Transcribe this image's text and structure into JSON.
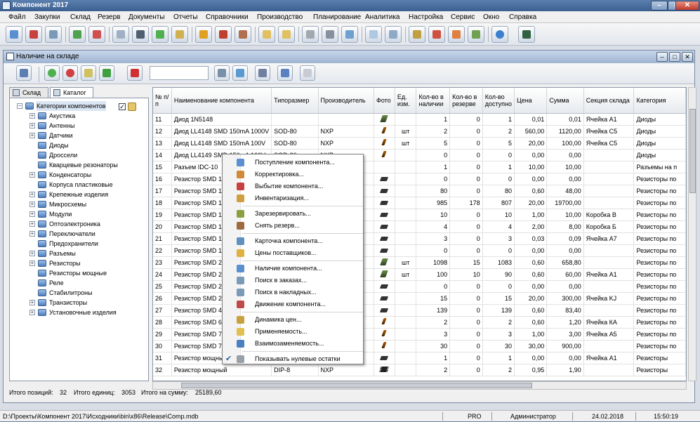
{
  "app": {
    "title": "Компонент 2017"
  },
  "menu": [
    "Файл",
    "Закупки",
    "Склад",
    "Резерв",
    "Документы",
    "Отчеты",
    "Справочники",
    "Производство",
    "Планирование",
    "Аналитика",
    "Настройка",
    "Сервис",
    "Окно",
    "Справка"
  ],
  "child": {
    "title": "Наличие на складе"
  },
  "left_tabs": [
    "Склад",
    "Каталог"
  ],
  "tree": {
    "root": "Категории компонентов",
    "items": [
      "Акустика",
      "Антенны",
      "Датчики",
      "Диоды",
      "Дроссели",
      "Кварцевые резонаторы",
      "Конденсаторы",
      "Корпуса пластиковые",
      "Крепежные изделия",
      "Микросхемы",
      "Модули",
      "Оптоэлектроника",
      "Переключатели",
      "Предохранители",
      "Разъемы",
      "Резисторы",
      "Резисторы мощные",
      "Реле",
      "Стабилитроны",
      "Транзисторы",
      "Установочные изделия"
    ]
  },
  "table": {
    "headers": [
      "№ п/п",
      "Наименование компонента",
      "Типоразмер",
      "Производитель",
      "Фото",
      "Ед. изм.",
      "Кол-во в наличии",
      "Кол-во в резерве",
      "Кол-во доступно",
      "Цена",
      "Сумма",
      "Секция склада",
      "Категория"
    ],
    "rows": [
      [
        "11",
        "Диод 1N5148",
        "",
        "",
        "",
        "",
        "1",
        "0",
        "1",
        "0,01",
        "0,01",
        "Ячейка А1",
        "Диоды"
      ],
      [
        "12",
        "Диод LL4148 SMD 150mA 1000V",
        "SOD-80",
        "NXP",
        "",
        "шт",
        "2",
        "0",
        "2",
        "560,00",
        "1120,00",
        "Ячейка С5",
        "Диоды"
      ],
      [
        "13",
        "Диод LL4148 SMD 150mA 100V",
        "SOD-80",
        "NXP",
        "",
        "шт",
        "5",
        "0",
        "5",
        "20,00",
        "100,00",
        "Ячейка С5",
        "Диоды"
      ],
      [
        "14",
        "Диод LL4149 SMD 150mA 100V",
        "SOD-80",
        "NXP",
        "",
        "",
        "0",
        "0",
        "0",
        "0,00",
        "0,00",
        "",
        "Диоды"
      ],
      [
        "15",
        "Разъем IDC-10",
        "",
        "",
        "",
        "",
        "1",
        "0",
        "1",
        "10,00",
        "10,00",
        "",
        "Разъемы на п"
      ],
      [
        "16",
        "Резистор SMD 1",
        "",
        "",
        "",
        "",
        "0",
        "0",
        "0",
        "0,00",
        "0,00",
        "",
        "Резисторы по"
      ],
      [
        "17",
        "Резистор SMD 1",
        "",
        "",
        "",
        "",
        "80",
        "0",
        "80",
        "0,60",
        "48,00",
        "",
        "Резисторы по"
      ],
      [
        "18",
        "Резистор SMD 1",
        "",
        "",
        "",
        "",
        "985",
        "178",
        "807",
        "20,00",
        "19700,00",
        "",
        "Резисторы по"
      ],
      [
        "19",
        "Резистор SMD 1",
        "",
        "",
        "",
        "",
        "10",
        "0",
        "10",
        "1,00",
        "10,00",
        "Коробка В",
        "Резисторы по"
      ],
      [
        "20",
        "Резистор SMD 1",
        "",
        "",
        "",
        "",
        "4",
        "0",
        "4",
        "2,00",
        "8,00",
        "Коробка Б",
        "Резисторы по"
      ],
      [
        "21",
        "Резистор SMD 1",
        "",
        "",
        "",
        "",
        "3",
        "0",
        "3",
        "0,03",
        "0,09",
        "Ячейка А7",
        "Резисторы по"
      ],
      [
        "22",
        "Резистор SMD 1",
        "",
        "",
        "",
        "",
        "0",
        "0",
        "0",
        "0,00",
        "0,00",
        "",
        "Резисторы по"
      ],
      [
        "23",
        "Резистор SMD 2",
        "",
        "",
        "",
        "шт",
        "1098",
        "15",
        "1083",
        "0,60",
        "658,80",
        "",
        "Резисторы по"
      ],
      [
        "24",
        "Резистор SMD 2",
        "",
        "",
        "",
        "шт",
        "100",
        "10",
        "90",
        "0,60",
        "60,00",
        "Ячейка А1",
        "Резисторы по"
      ],
      [
        "25",
        "Резистор SMD 2",
        "",
        "",
        "",
        "",
        "0",
        "0",
        "0",
        "0,00",
        "0,00",
        "",
        "Резисторы по"
      ],
      [
        "26",
        "Резистор SMD 2",
        "",
        "",
        "",
        "",
        "15",
        "0",
        "15",
        "20,00",
        "300,00",
        "Ячейка KJ",
        "Резисторы по"
      ],
      [
        "27",
        "Резистор SMD 4",
        "",
        "",
        "",
        "",
        "139",
        "0",
        "139",
        "0,60",
        "83,40",
        "",
        "Резисторы по"
      ],
      [
        "28",
        "Резистор SMD 6",
        "",
        "",
        "",
        "",
        "2",
        "0",
        "2",
        "0,60",
        "1,20",
        "Ячейка КА",
        "Резисторы по"
      ],
      [
        "29",
        "Резистор SMD 7",
        "",
        "",
        "",
        "",
        "3",
        "0",
        "3",
        "1,00",
        "3,00",
        "Ячейка А5",
        "Резисторы по"
      ],
      [
        "30",
        "Резистор SMD 7",
        "",
        "",
        "",
        "",
        "30",
        "0",
        "30",
        "30,00",
        "900,00",
        "",
        "Резисторы по"
      ],
      [
        "31",
        "Резистор мощны",
        "",
        "",
        "",
        "",
        "1",
        "0",
        "1",
        "0,00",
        "0,00",
        "Ячейка А1",
        "Резисторы"
      ],
      [
        "32",
        "Резистор мощный",
        "DIP-8",
        "NXP",
        "",
        "",
        "2",
        "0",
        "2",
        "0,95",
        "1,90",
        "",
        "Резисторы"
      ]
    ],
    "photos": [
      "g",
      "led",
      "led",
      "led",
      "",
      "pin",
      "pin",
      "pin",
      "pin",
      "pin",
      "pin",
      "pin",
      "g",
      "g",
      "pin",
      "pin",
      "pin",
      "led",
      "led",
      "led",
      "pin",
      "dip"
    ]
  },
  "child_status": {
    "positions_label": "Итого позиций:",
    "positions": "32",
    "units_label": "Итого единиц:",
    "units": "3053",
    "sum_label": "Итого на сумму:",
    "sum": "25189,60"
  },
  "context_menu": [
    {
      "label": "Поступление компонента...",
      "color": "#5a8fd0"
    },
    {
      "label": "Корректировка...",
      "color": "#d08a3a"
    },
    {
      "label": "Выбытие компонента...",
      "color": "#c84040"
    },
    {
      "label": "Инвентаризация...",
      "color": "#d0a040"
    },
    {
      "sep": true
    },
    {
      "label": "Зарезервировать...",
      "color": "#8aa040"
    },
    {
      "label": "Снять резерв...",
      "color": "#a06a40"
    },
    {
      "sep": true
    },
    {
      "label": "Карточка компонента...",
      "color": "#6090c0"
    },
    {
      "label": "Цены поставщиков...",
      "color": "#e0b040"
    },
    {
      "sep": true
    },
    {
      "label": "Наличие компонента...",
      "color": "#5a8fd0"
    },
    {
      "label": "Поиск в заказах...",
      "color": "#7a9ab8"
    },
    {
      "label": "Поиск в накладных...",
      "color": "#7a9ab8"
    },
    {
      "label": "Движение компонента...",
      "color": "#c04a4a"
    },
    {
      "sep": true
    },
    {
      "label": "Динамика цен...",
      "color": "#c8a040"
    },
    {
      "label": "Применяемость...",
      "color": "#e0c050"
    },
    {
      "label": "Взаимозаменяемость...",
      "color": "#4a7fc0"
    },
    {
      "sep": true
    },
    {
      "label": "Показывать нулевые остатки",
      "color": "#9aa0a8",
      "checked": true
    }
  ],
  "statusbar": {
    "path": "D:\\Проекты\\Компонент 2017\\Исходники\\bin\\x86\\Release\\Comp.mdb",
    "edition": "PRO",
    "user": "Администратор",
    "date": "24.02.2018",
    "time": "15:50:19"
  },
  "colors": {
    "accent": "#3b5f8f",
    "child_title": "#9eb4d2"
  }
}
